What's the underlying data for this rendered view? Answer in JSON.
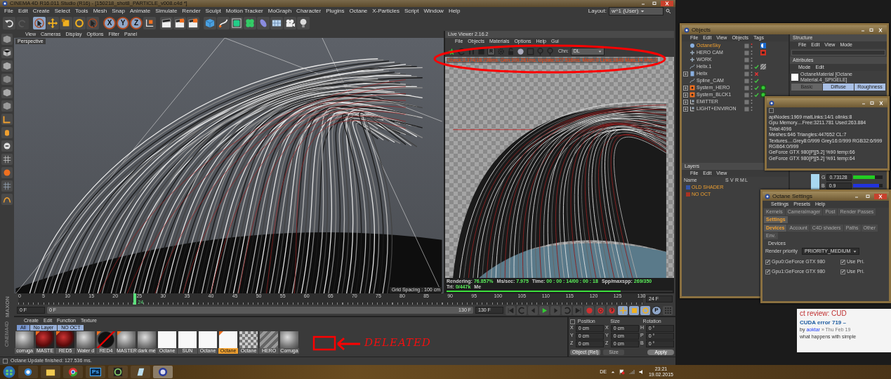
{
  "app": {
    "title": "CINEMA 4D R16.011 Studio (R16) - [150218_shot8_PARTICLE_v008.c4d *]",
    "menu": [
      "File",
      "Edit",
      "Create",
      "Select",
      "Tools",
      "Mesh",
      "Snap",
      "Animate",
      "Simulate",
      "Render",
      "Sculpt",
      "Motion Tracker",
      "MoGraph",
      "Character",
      "Plugins",
      "Octane",
      "X-Particles",
      "Script",
      "Window",
      "Help"
    ],
    "layout_label": "Layout:",
    "layout_value": "w^1 (User)",
    "tools": [
      {
        "kind": "select",
        "selected": true
      },
      {
        "kind": "move",
        "selected": false
      },
      {
        "kind": "scale",
        "selected": false
      },
      {
        "kind": "rotate",
        "selected": false
      },
      {
        "kind": "live-select",
        "selected": false
      }
    ],
    "axis_buttons": [
      {
        "label": "X",
        "selected": true
      },
      {
        "label": "Y",
        "selected": true
      },
      {
        "label": "Z",
        "selected": true
      }
    ],
    "brand": [
      "MAXON",
      "CINEMA4D"
    ]
  },
  "viewport": {
    "menu": [
      "View",
      "Cameras",
      "Display",
      "Options",
      "Filter",
      "Panel"
    ],
    "camera": "Perspective",
    "grid_spacing": "Grid Spacing : 100 cm"
  },
  "live_viewer": {
    "title": "Live Viewer 2.16.2",
    "menu": [
      "File",
      "Objects",
      "Materials",
      "Options",
      "Help",
      "Gui"
    ],
    "key_label": "R",
    "channel_label": "Chn:",
    "channel_value": "DL",
    "stats": "Check:3.374/18.738ms. Gen:109.261ms. Update:127.536ms. Mesh:0 Links:1840 Mats:14 Mvb:0",
    "status": [
      {
        "label": "Rendering:",
        "value": "76.857%"
      },
      {
        "label": "Ms/sec:",
        "value": "7.975"
      },
      {
        "label": "Time:",
        "value": "00 : 00 : 14/00 : 00 : 18"
      },
      {
        "label": "Spp/maxspp:",
        "value": "269/350"
      },
      {
        "label": "Tri:",
        "value": "0/447k"
      },
      {
        "label": "Me"
      }
    ],
    "level": 0.769
  },
  "timeline": {
    "ticks": [
      "0",
      "5",
      "10",
      "15",
      "20",
      "25",
      "30",
      "35",
      "40",
      "45",
      "50",
      "55",
      "60",
      "65",
      "70",
      "75",
      "80",
      "85",
      "90",
      "95",
      "100",
      "105",
      "110",
      "115",
      "120",
      "125",
      "130"
    ],
    "playhead": {
      "label": "24",
      "level": 0.1846
    },
    "start_field": "0 F",
    "start_slider": "0 F",
    "end_slider": "130 F",
    "end_field": "130 F",
    "fps": "24 F",
    "param_key": "P"
  },
  "materials": {
    "menu": [
      "Create",
      "Edit",
      "Function",
      "Texture"
    ],
    "filters": [
      {
        "label": "All",
        "selected": true
      },
      {
        "label": "No Layer",
        "selected": false
      },
      {
        "label": "NO OCT",
        "selected": false
      }
    ],
    "items": [
      {
        "name": "corruga",
        "kind": "grey",
        "tagged": false,
        "selected": false
      },
      {
        "name": "MASTE",
        "kind": "red",
        "tagged": true,
        "selected": false
      },
      {
        "name": "RED5",
        "kind": "red",
        "tagged": true,
        "selected": false
      },
      {
        "name": "Water d",
        "kind": "grey",
        "tagged": false,
        "selected": false
      },
      {
        "name": "RED4",
        "kind": "black",
        "tagged": true,
        "selected": false
      },
      {
        "name": "MASTER",
        "kind": "grey",
        "tagged": true,
        "selected": false
      },
      {
        "name": "dark me",
        "kind": "grey",
        "tagged": false,
        "selected": false
      },
      {
        "name": "Octane",
        "kind": "white",
        "tagged": false,
        "selected": false
      },
      {
        "name": "SUN",
        "kind": "white",
        "tagged": false,
        "selected": false
      },
      {
        "name": "Octane",
        "kind": "white",
        "tagged": false,
        "selected": false
      },
      {
        "name": "Octane",
        "kind": "white",
        "tagged": true,
        "selected": true
      },
      {
        "name": "Octane",
        "kind": "checker",
        "tagged": false,
        "selected": false
      },
      {
        "name": "HERO",
        "kind": "stripes",
        "tagged": false,
        "selected": false
      },
      {
        "name": "Corruga",
        "kind": "grey",
        "tagged": false,
        "selected": false
      }
    ],
    "annotation": "DELEATED"
  },
  "coordinates": {
    "checked": false,
    "headers": [
      "Position",
      "Size",
      "Rotation"
    ],
    "rows": [
      {
        "axes": [
          "X",
          "X",
          "H"
        ],
        "values": [
          "0 cm",
          "0 cm",
          "0 °"
        ]
      },
      {
        "axes": [
          "Y",
          "Y",
          "P"
        ],
        "values": [
          "0 cm",
          "0 cm",
          "0 °"
        ]
      },
      {
        "axes": [
          "Z",
          "Z",
          "B"
        ],
        "values": [
          "0 cm",
          "0 cm",
          "0 °"
        ]
      }
    ],
    "mode": "Object (Rel)",
    "size_mode": "Size",
    "apply": "Apply"
  },
  "status_bar": "Octane:Update finished: 127.536 ms.",
  "objects": {
    "title": "Objects",
    "menu": [
      "File",
      "Edit",
      "View",
      "Objects",
      "Tags"
    ],
    "items": [
      {
        "name": "OctaneSky",
        "kind": "sky",
        "expandable": false,
        "selected": true,
        "tag": {
          "kind": "sky"
        }
      },
      {
        "name": "HERO CAM",
        "kind": "null",
        "expandable": false,
        "selected": false,
        "tag": {
          "kind": "camera"
        }
      },
      {
        "name": "WORK",
        "kind": "null",
        "expandable": false,
        "selected": false
      },
      {
        "name": "Helix.1",
        "kind": "spline",
        "expandable": false,
        "selected": false,
        "flag": {
          "kind": "check"
        },
        "tag": {
          "kind": "hatch"
        }
      },
      {
        "name": "Helix",
        "kind": "doc",
        "expandable": true,
        "selected": false,
        "flag": {
          "kind": "cross"
        }
      },
      {
        "name": "Spline_CAM",
        "kind": "spline",
        "expandable": false,
        "selected": false,
        "flag": {
          "kind": "check"
        }
      },
      {
        "name": "System_HERO",
        "kind": "system",
        "expandable": true,
        "selected": false,
        "flag": {
          "kind": "check"
        },
        "tag": {
          "kind": "sphere"
        }
      },
      {
        "name": "System_BLCK1",
        "kind": "system",
        "expandable": true,
        "selected": false,
        "flag": {
          "kind": "check"
        },
        "tag": {
          "kind": "sphere"
        }
      },
      {
        "name": "EMITTER",
        "kind": "layer",
        "expandable": true,
        "selected": false
      },
      {
        "name": "LIGHT+ENVIRON",
        "kind": "layer",
        "expandable": true,
        "selected": false
      }
    ],
    "structure": {
      "title": "Structure",
      "menu": [
        "File",
        "Edit",
        "View",
        "Mode"
      ]
    },
    "attributes": {
      "title": "Attributes",
      "menu": [
        "Mode",
        "Edit"
      ],
      "material": "OctaneMaterial [Octane Material.4_SPIGELE]",
      "tabs": [
        {
          "label": "Basic",
          "selected": false
        },
        {
          "label": "Diffuse",
          "selected": true
        },
        {
          "label": "Roughness",
          "selected": true
        }
      ],
      "color_fields": [
        {
          "label": "G",
          "value": "0.73128",
          "level": 0.73,
          "color": "#22cc22"
        },
        {
          "label": "B",
          "value": "0.9",
          "level": 0.9,
          "color": "#2233dd"
        }
      ]
    },
    "layers": {
      "title": "Layers",
      "menu": [
        "File",
        "Edit",
        "View"
      ],
      "columns": [
        "Name",
        "S",
        "V",
        "R",
        "M",
        "L"
      ],
      "rows": [
        {
          "name": "OLD SHADER",
          "color": "#3355aa"
        },
        {
          "name": "NO OCT",
          "color": "#aa3322"
        }
      ]
    }
  },
  "info_window": {
    "checked": false,
    "lines": [
      "apiNodes:1969  matLinks:14/1  olinks:8",
      "Gpu Memory....Free:3211.781 Used:263.884 Total:4096",
      "Meshes:646 Triangles:447652 CL:7",
      "Textures....Grey8:0/999  Grey16:0/999  RGB32:6/999  RGB64:0/999",
      "GeForce GTX 980[P][5.2] %90 temp:66",
      "GeForce GTX 980[P][5.2] %91 temp:64"
    ]
  },
  "octane_settings": {
    "title": "Octane Settings",
    "menu": [
      "Settings",
      "Presets",
      "Help"
    ],
    "tabs": [
      {
        "label": "Kernels",
        "selected": false
      },
      {
        "label": "CameraImager",
        "selected": false
      },
      {
        "label": "Post",
        "selected": false
      },
      {
        "label": "Render Passes",
        "selected": false
      },
      {
        "label": "Settings",
        "selected": true
      }
    ],
    "subtabs": [
      {
        "label": "Devices",
        "selected": true
      },
      {
        "label": "Account",
        "selected": false
      },
      {
        "label": "C4D shaders",
        "selected": false
      },
      {
        "label": "Paths",
        "selected": false
      },
      {
        "label": "Other",
        "selected": false
      },
      {
        "label": "Env.",
        "selected": false
      }
    ],
    "group": "Devices",
    "priority_label": "Render priority",
    "priority_value": "PRIORITY_MEDIUM",
    "devices": [
      {
        "name": "Gpu0:GeForce GTX 980",
        "checked": true,
        "use_pri": "Use Pri.",
        "use_pri_checked": true
      },
      {
        "name": "Gpu1:GeForce GTX 980",
        "checked": true,
        "use_pri": "Use Pri.",
        "use_pri_checked": true
      }
    ]
  },
  "browser": {
    "title": "ct review: CUD",
    "post": "CUDA error 719 –",
    "by": "by",
    "author": "aoktar",
    "date": "» Thu Feb 19",
    "excerpt": "what happens with simple"
  },
  "taskbar": {
    "apps": [
      {
        "kind": "globe",
        "selected": false
      },
      {
        "kind": "folder",
        "selected": false
      },
      {
        "kind": "chrome",
        "selected": false
      },
      {
        "kind": "ps",
        "text": "Ps",
        "selected": false
      },
      {
        "kind": "disc",
        "selected": false
      },
      {
        "kind": "pad",
        "selected": false
      },
      {
        "kind": "sphere",
        "selected": true
      }
    ],
    "language": "DE",
    "time": "23:21",
    "date": "19.02.2015"
  }
}
